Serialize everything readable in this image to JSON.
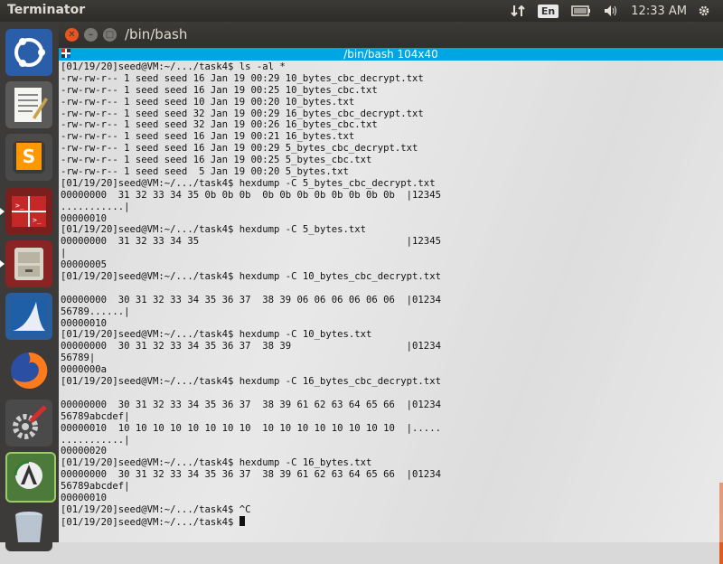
{
  "app_title": "Terminator",
  "tray": {
    "keyboard_layout": "En",
    "clock": "12:33 AM"
  },
  "window": {
    "title": "/bin/bash",
    "header_title": "/bin/bash 104x40"
  },
  "launcher": {
    "items": [
      "ubuntu-dash",
      "text-editor",
      "sublime-text",
      "terminator",
      "file-manager",
      "wireshark",
      "firefox",
      "system-settings",
      "software-updater",
      "trash"
    ]
  },
  "terminal": {
    "prompt": "[01/19/20]seed@VM:~/.../task4$ ",
    "lines": [
      "[01/19/20]seed@VM:~/.../task4$ ls -al *",
      "-rw-rw-r-- 1 seed seed 16 Jan 19 00:29 10_bytes_cbc_decrypt.txt",
      "-rw-rw-r-- 1 seed seed 16 Jan 19 00:25 10_bytes_cbc.txt",
      "-rw-rw-r-- 1 seed seed 10 Jan 19 00:20 10_bytes.txt",
      "-rw-rw-r-- 1 seed seed 32 Jan 19 00:29 16_bytes_cbc_decrypt.txt",
      "-rw-rw-r-- 1 seed seed 32 Jan 19 00:26 16_bytes_cbc.txt",
      "-rw-rw-r-- 1 seed seed 16 Jan 19 00:21 16_bytes.txt",
      "-rw-rw-r-- 1 seed seed 16 Jan 19 00:29 5_bytes_cbc_decrypt.txt",
      "-rw-rw-r-- 1 seed seed 16 Jan 19 00:25 5_bytes_cbc.txt",
      "-rw-rw-r-- 1 seed seed  5 Jan 19 00:20 5_bytes.txt",
      "[01/19/20]seed@VM:~/.../task4$ hexdump -C 5_bytes_cbc_decrypt.txt",
      "00000000  31 32 33 34 35 0b 0b 0b  0b 0b 0b 0b 0b 0b 0b 0b  |12345",
      "...........|",
      "00000010",
      "[01/19/20]seed@VM:~/.../task4$ hexdump -C 5_bytes.txt",
      "00000000  31 32 33 34 35                                    |12345",
      "|",
      "00000005",
      "[01/19/20]seed@VM:~/.../task4$ hexdump -C 10_bytes_cbc_decrypt.txt",
      "",
      "00000000  30 31 32 33 34 35 36 37  38 39 06 06 06 06 06 06  |01234",
      "56789......|",
      "00000010",
      "[01/19/20]seed@VM:~/.../task4$ hexdump -C 10_bytes.txt",
      "00000000  30 31 32 33 34 35 36 37  38 39                    |01234",
      "56789|",
      "0000000a",
      "[01/19/20]seed@VM:~/.../task4$ hexdump -C 16_bytes_cbc_decrypt.txt",
      "",
      "00000000  30 31 32 33 34 35 36 37  38 39 61 62 63 64 65 66  |01234",
      "56789abcdef|",
      "00000010  10 10 10 10 10 10 10 10  10 10 10 10 10 10 10 10  |.....",
      "...........|",
      "00000020",
      "[01/19/20]seed@VM:~/.../task4$ hexdump -C 16_bytes.txt",
      "00000000  30 31 32 33 34 35 36 37  38 39 61 62 63 64 65 66  |01234",
      "56789abcdef|",
      "00000010",
      "[01/19/20]seed@VM:~/.../task4$ ^C"
    ]
  },
  "colors": {
    "panel": "#3c3b37",
    "launcher": "#3d3a3a",
    "header_accent": "#00a6e2",
    "close_button": "#e95420"
  }
}
